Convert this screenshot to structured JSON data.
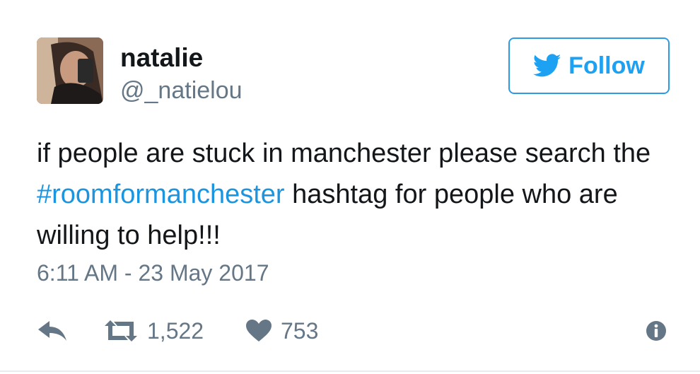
{
  "user": {
    "display_name": "natalie",
    "handle": "@_natielou"
  },
  "follow_button": {
    "label": "Follow"
  },
  "tweet": {
    "text_before": "if people are stuck in manchester please search the ",
    "hashtag": "#roomformanchester",
    "text_after": " hashtag for people who are willing to help!!!",
    "timestamp": "6:11 AM - 23 May 2017"
  },
  "actions": {
    "retweet_count": "1,522",
    "like_count": "753"
  },
  "icons": {
    "reply": "reply-icon",
    "retweet": "retweet-icon",
    "like": "heart-icon",
    "info": "info-icon",
    "follow": "twitter-bird-icon"
  },
  "colors": {
    "brand_blue": "#1da1f2",
    "hashtag_blue": "#1b95e0",
    "muted_gray": "#657786",
    "text": "#14171a"
  }
}
